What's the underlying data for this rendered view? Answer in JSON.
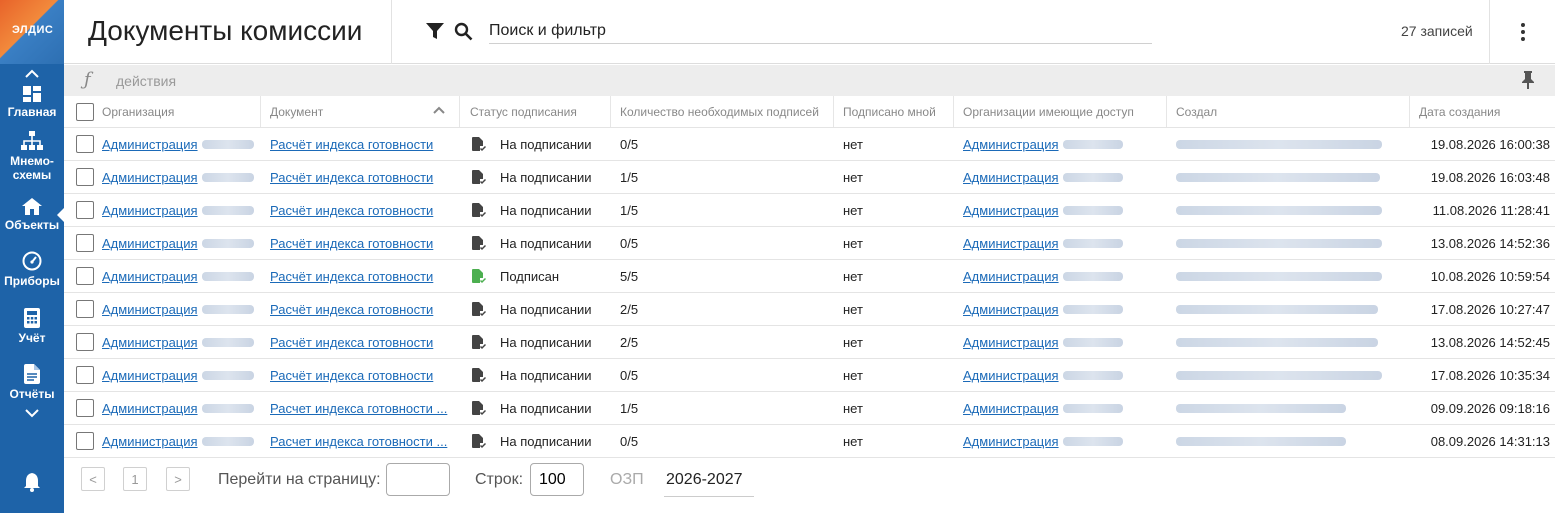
{
  "sidebar": {
    "logo_text": "ЭЛДИС",
    "items": [
      {
        "label": "Главная",
        "icon": "dashboard-icon"
      },
      {
        "label": "Мнемо-схемы",
        "label1": "Мнемо-",
        "label2": "схемы",
        "icon": "hierarchy-icon"
      },
      {
        "label": "Объекты",
        "icon": "home-icon",
        "active": true
      },
      {
        "label": "Приборы",
        "icon": "gauge-icon"
      },
      {
        "label": "Учёт",
        "icon": "calculator-icon"
      },
      {
        "label": "Отчёты",
        "icon": "report-icon"
      }
    ]
  },
  "header": {
    "title": "Документы комиссии",
    "search_placeholder": "Поиск и фильтр",
    "records": "27 записей"
  },
  "actions": {
    "fx": "ƒ",
    "label": "действия"
  },
  "table": {
    "columns": [
      "Организация",
      "Документ",
      "Статус подписания",
      "Количество необходимых подписей",
      "Подписано мной",
      "Организации имеющие доступ",
      "Создал",
      "Дата создания"
    ],
    "rows": [
      {
        "org": "Администрация",
        "doc": "Расчёт индекса готовности",
        "status": "На подписании",
        "signed": false,
        "count": "0/5",
        "mine": "нет",
        "access": "Администрация",
        "date": "19.08.2026 16:00:38"
      },
      {
        "org": "Администрация",
        "doc": "Расчёт индекса готовности",
        "status": "На подписании",
        "signed": false,
        "count": "1/5",
        "mine": "нет",
        "access": "Администрация",
        "date": "19.08.2026 16:03:48"
      },
      {
        "org": "Администрация",
        "doc": "Расчёт индекса готовности",
        "status": "На подписании",
        "signed": false,
        "count": "1/5",
        "mine": "нет",
        "access": "Администрация",
        "date": "11.08.2026 11:28:41"
      },
      {
        "org": "Администрация",
        "doc": "Расчёт индекса готовности",
        "status": "На подписании",
        "signed": false,
        "count": "0/5",
        "mine": "нет",
        "access": "Администрация",
        "date": "13.08.2026 14:52:36"
      },
      {
        "org": "Администрация",
        "doc": "Расчёт индекса готовности",
        "status": "Подписан",
        "signed": true,
        "count": "5/5",
        "mine": "нет",
        "access": "Администрация",
        "date": "10.08.2026 10:59:54"
      },
      {
        "org": "Администрация",
        "doc": "Расчёт индекса готовности",
        "status": "На подписании",
        "signed": false,
        "count": "2/5",
        "mine": "нет",
        "access": "Администрация",
        "date": "17.08.2026 10:27:47"
      },
      {
        "org": "Администрация",
        "doc": "Расчёт индекса готовности",
        "status": "На подписании",
        "signed": false,
        "count": "2/5",
        "mine": "нет",
        "access": "Администрация",
        "date": "13.08.2026 14:52:45"
      },
      {
        "org": "Администрация",
        "doc": "Расчёт индекса готовности",
        "status": "На подписании",
        "signed": false,
        "count": "0/5",
        "mine": "нет",
        "access": "Администрация",
        "date": "17.08.2026 10:35:34"
      },
      {
        "org": "Администрация",
        "doc": "Расчет индекса готовности ...",
        "status": "На подписании",
        "signed": false,
        "count": "1/5",
        "mine": "нет",
        "access": "Администрация",
        "date": "09.09.2026 09:18:16"
      },
      {
        "org": "Администрация",
        "doc": "Расчет индекса готовности ...",
        "status": "На подписании",
        "signed": false,
        "count": "0/5",
        "mine": "нет",
        "access": "Администрация",
        "date": "08.09.2026 14:31:13"
      }
    ]
  },
  "footer": {
    "prev": "<",
    "page": "1",
    "next": ">",
    "goto_label": "Перейти на страницу:",
    "rows_label": "Строк:",
    "rows_value": "100",
    "ozp_label": "ОЗП",
    "ozp_value": "2026-2027"
  },
  "colors": {
    "sidebar": "#1e63a8",
    "link": "#1b6ab8",
    "signed_icon": "#4caf50"
  }
}
